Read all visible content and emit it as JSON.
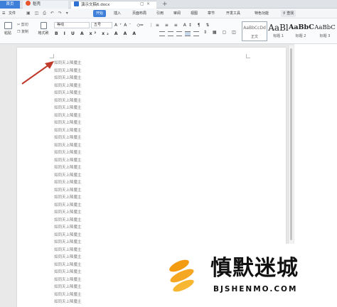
{
  "tabs": {
    "home": "首页",
    "daoke": "稻壳",
    "document": "演示文稿6.docx",
    "add": "+"
  },
  "menubar": {
    "file": "文件",
    "items": [
      "开始",
      "插入",
      "页面布局",
      "引用",
      "审阅",
      "视图",
      "章节",
      "开发工具",
      "特色功能"
    ],
    "search": "查找"
  },
  "ribbon": {
    "paste": "粘贴",
    "cut": "剪切",
    "copy": "复制",
    "format_painter": "格式刷",
    "font_name": "等线",
    "font_size": "五号",
    "styles": [
      {
        "preview": "AaBbCcDd",
        "caption": "正文"
      },
      {
        "preview": "AaBl",
        "caption": "标题 1"
      },
      {
        "preview": "AaBbC",
        "caption": "标题 2"
      },
      {
        "preview": "AaBbC",
        "caption": "标题 3"
      }
    ]
  },
  "document": {
    "lines": [
      "如同天上降魔主",
      "如同天上降魔主",
      "如同天上降魔主",
      "如同天上降魔主",
      "如同天上降魔主",
      "如同天上降魔主",
      "如同天上降魔主",
      "如同天上降魔主",
      "如同天上降魔主",
      "如同天上降魔主",
      "如同天上降魔主",
      "如同天上降魔主",
      "如同天上降魔主",
      "如同天上降魔主",
      "如同天上降魔主",
      "如同天上降魔主",
      "如同天上降魔主",
      "如同天上降魔主",
      "如同天上降魔主",
      "如同天上降魔主",
      "如同天上降魔主",
      "如同天上降魔主",
      "如同天上降魔主",
      "如同天上降魔主",
      "如同天上降魔主",
      "如同天上降魔主",
      "如同天上降魔主",
      "如同天上降魔主",
      "如同天上降魔主",
      "如同天上降魔主",
      "如同天上降魔主",
      "如同天上降魔主",
      "如同天上降魔主",
      "如同天上降魔主"
    ]
  },
  "watermark": {
    "title": "慎默迷城",
    "subtitle": "BJSHENMO.COM"
  },
  "colors": {
    "accent": "#3d7fd9",
    "arrow": "#c0392b",
    "logo_orange": "#f39c12"
  }
}
